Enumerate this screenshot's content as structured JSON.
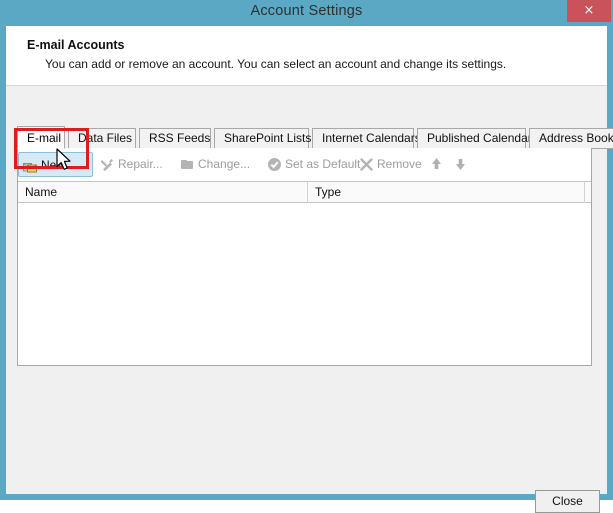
{
  "window": {
    "title": "Account Settings",
    "close_icon_label": "×"
  },
  "header": {
    "title": "E-mail Accounts",
    "description": "You can add or remove an account. You can select an account and change its settings."
  },
  "tabs": [
    {
      "label": "E-mail",
      "active": true
    },
    {
      "label": "Data Files",
      "active": false
    },
    {
      "label": "RSS Feeds",
      "active": false
    },
    {
      "label": "SharePoint Lists",
      "active": false
    },
    {
      "label": "Internet Calendars",
      "active": false
    },
    {
      "label": "Published Calendars",
      "active": false
    },
    {
      "label": "Address Books",
      "active": false
    }
  ],
  "toolbar": {
    "new_label": "New...",
    "repair_label": "Repair...",
    "change_label": "Change...",
    "set_default_label": "Set as Default",
    "remove_label": "Remove",
    "move_up_label": "Move Up",
    "move_down_label": "Move Down"
  },
  "table": {
    "columns": [
      "Name",
      "Type"
    ],
    "rows": []
  },
  "footer": {
    "close_label": "Close"
  },
  "colors": {
    "title_bar": "#5aa8c4",
    "close_button": "#c9535a",
    "highlight_box": "#e01b1b",
    "hover_fill": "#d6e9f5",
    "disabled_text": "#9d9d9d"
  }
}
